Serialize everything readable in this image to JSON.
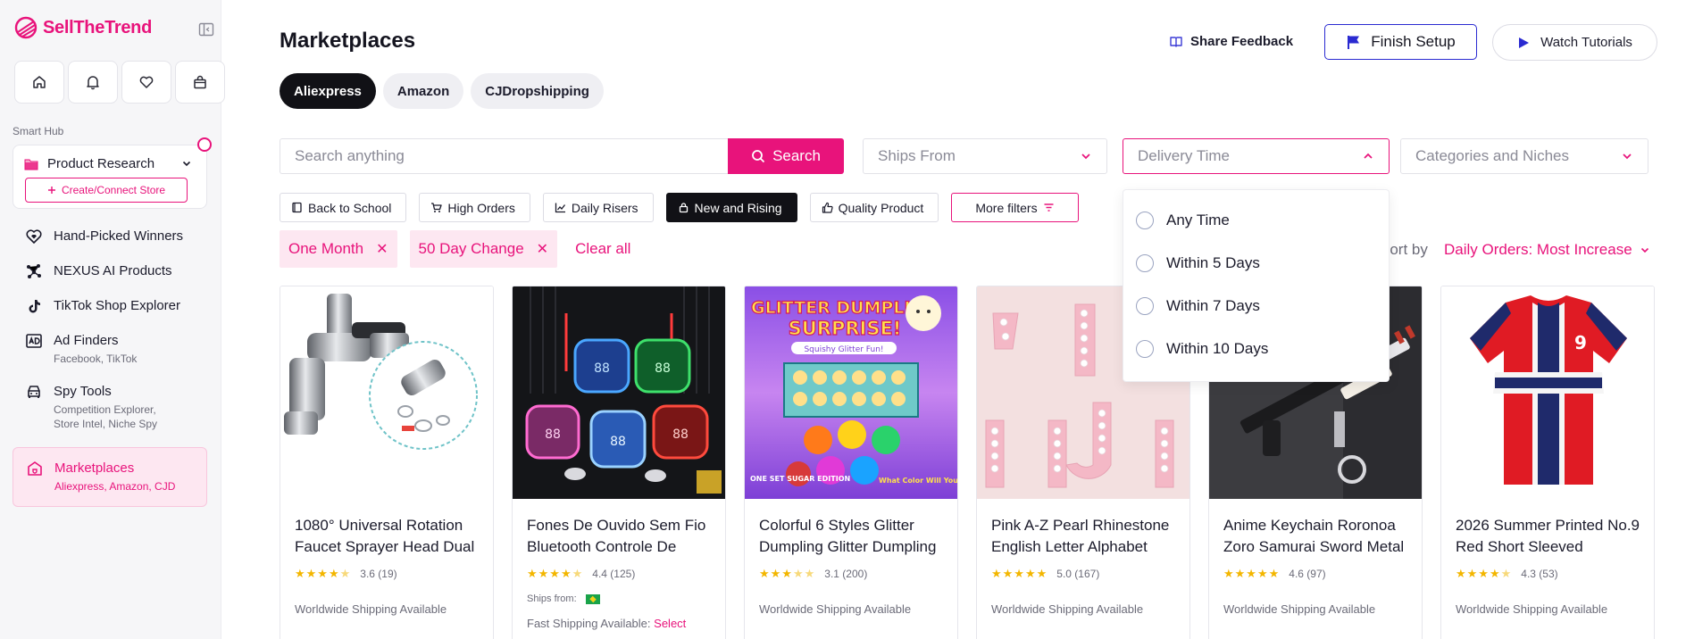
{
  "brand": {
    "sell": "Sell",
    "the": "The",
    "trend": "Trend",
    "accent": "#e8137b"
  },
  "sidebar": {
    "smart_hub_label": "Smart Hub",
    "product_research": "Product Research",
    "create_store": "Create/Connect Store",
    "items": [
      {
        "label": "Hand-Picked Winners",
        "sub": "",
        "icon": "heart-gem-icon"
      },
      {
        "label": "NEXUS AI Products",
        "sub": "",
        "icon": "nexus-network-icon"
      },
      {
        "label": "TikTok Shop Explorer",
        "sub": "",
        "icon": "tiktok-icon"
      },
      {
        "label": "Ad Finders",
        "sub": "Facebook, TikTok",
        "icon": "ad-icon"
      },
      {
        "label": "Spy Tools",
        "sub": "Competition Explorer, Store Intel, Niche Spy",
        "icon": "spy-car-icon"
      },
      {
        "label": "Marketplaces",
        "sub": "Aliexpress, Amazon, CJD",
        "icon": "store-icon"
      }
    ]
  },
  "header": {
    "title": "Marketplaces",
    "feedback": "Share Feedback",
    "finish_setup": "Finish Setup",
    "watch_tutorials": "Watch Tutorials"
  },
  "tabs": [
    "Aliexpress",
    "Amazon",
    "CJDropshipping"
  ],
  "search": {
    "placeholder": "Search anything",
    "button": "Search"
  },
  "selects": {
    "ships_from": "Ships From",
    "delivery_time": "Delivery Time",
    "categories": "Categories and Niches"
  },
  "chips": [
    "Back to School",
    "High Orders",
    "Daily Risers",
    "New and Rising",
    "Quality Product",
    "More filters"
  ],
  "active_filters": [
    "One Month",
    "50 Day Change"
  ],
  "clear_all": "Clear all",
  "sort": {
    "label": "Sort by",
    "value": "Daily Orders: Most Increase"
  },
  "dropdown_options": [
    "Any Time",
    "Within 5 Days",
    "Within 7 Days",
    "Within 10 Days"
  ],
  "products": [
    {
      "title": "1080° Universal Rotation Faucet Sprayer Head Dual",
      "rating": "3.6 (19)",
      "stars": 3.6,
      "ship": "Worldwide Shipping Available"
    },
    {
      "title": "Fones De Ouvido Sem Fio Bluetooth Controle De",
      "rating": "4.4 (125)",
      "stars": 4.4,
      "ships_from": "Ships from:",
      "fast": "Fast Shipping Available:",
      "fast_link": "Select"
    },
    {
      "title": "Colorful 6 Styles Glitter Dumpling Glitter Dumpling",
      "rating": "3.1 (200)",
      "stars": 3.1,
      "ship": "Worldwide Shipping Available",
      "image_text": {
        "title1": "GLITTER DUMPLING",
        "title2": "SURPRISE!",
        "banner": "Squishy Glitter Fun!",
        "left": "ONE SET SUGAR EDITION",
        "right": "What Color Will You Get?"
      }
    },
    {
      "title": "Pink A-Z Pearl Rhinestone English Letter Alphabet",
      "rating": "5.0 (167)",
      "stars": 5.0,
      "ship": "Worldwide Shipping Available"
    },
    {
      "title": "Anime Keychain Roronoa Zoro Samurai Sword Metal",
      "rating": "4.6 (97)",
      "stars": 4.6,
      "ship": "Worldwide Shipping Available"
    },
    {
      "title": "2026 Summer Printed No.9 Red Short Sleeved",
      "rating": "4.3 (53)",
      "stars": 4.3,
      "ship": "Worldwide Shipping Available"
    }
  ]
}
